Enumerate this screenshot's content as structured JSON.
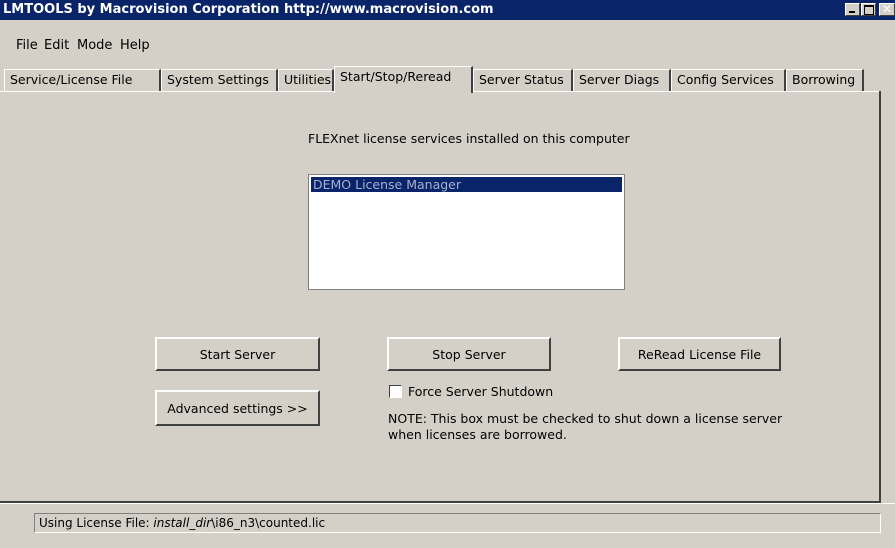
{
  "window": {
    "title": "LMTOOLS by Macrovision Corporation http://www.macrovision.com"
  },
  "menu": [
    "File",
    "Edit",
    "Mode",
    "Help"
  ],
  "tabs": [
    "Service/License File",
    "System Settings",
    "Utilities",
    "Start/Stop/Reread",
    "Server Status",
    "Server Diags",
    "Config Services",
    "Borrowing"
  ],
  "active_tab": "Start/Stop/Reread",
  "services": {
    "heading": "FLEXnet license services installed on this computer",
    "items": [
      "DEMO License Manager"
    ],
    "selected": "DEMO License Manager"
  },
  "buttons": {
    "start": "Start Server",
    "stop": "Stop Server",
    "reread": "ReRead License File",
    "advanced": "Advanced settings >>"
  },
  "force_shutdown": {
    "label": "Force Server Shutdown",
    "checked": false
  },
  "note": {
    "line1": "NOTE:  This box must be checked to shut down a license server",
    "line2": "when licenses are borrowed."
  },
  "status": {
    "prefix": "Using License File: ",
    "path_italic": "install_dir",
    "path_rest": "\\i86_n3\\counted.lic"
  },
  "colors": {
    "face": "#d4d0c8",
    "titlebar": "#0a246a",
    "selection": "#0a246a"
  }
}
